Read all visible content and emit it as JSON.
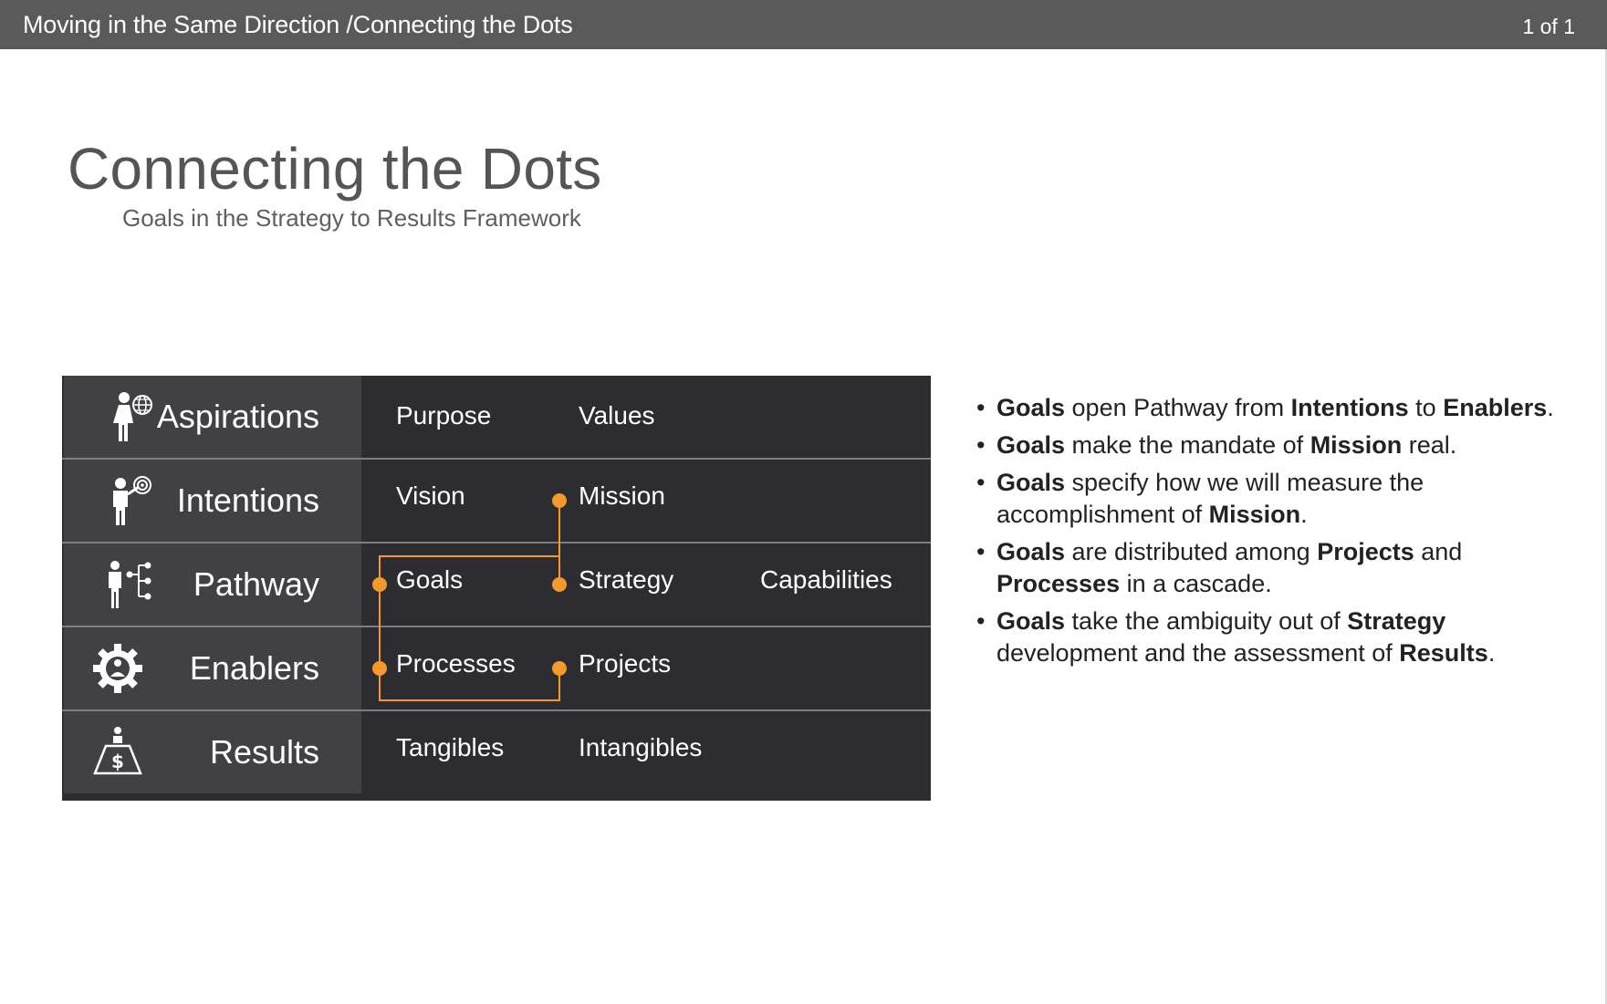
{
  "header": {
    "breadcrumb": "Moving in the Same Direction /Connecting the Dots",
    "page_counter": "1 of 1"
  },
  "slide": {
    "title": "Connecting the Dots",
    "subtitle": "Goals in the Strategy to Results Framework"
  },
  "framework": {
    "rows": [
      {
        "label": "Aspirations",
        "icon": "person-globe-icon",
        "items": [
          "Purpose",
          "Values"
        ]
      },
      {
        "label": "Intentions",
        "icon": "person-target-icon",
        "items": [
          "Vision",
          "Mission"
        ]
      },
      {
        "label": "Pathway",
        "icon": "person-flowchart-icon",
        "items": [
          "Goals",
          "Strategy",
          "Capabilities"
        ]
      },
      {
        "label": "Enablers",
        "icon": "gear-person-icon",
        "items": [
          "Processes",
          "Projects"
        ]
      },
      {
        "label": "Results",
        "icon": "person-dollar-pedestal-icon",
        "items": [
          "Tangibles",
          "Intangibles"
        ]
      }
    ],
    "connector_color": "#f39a2b",
    "panel_color": "#2d2c30",
    "header_color": "#414145"
  },
  "bullets": [
    {
      "parts": [
        {
          "t": "Goals",
          "b": true
        },
        {
          "t": " open Pathway from ",
          "b": false
        },
        {
          "t": "Intentions",
          "b": true
        },
        {
          "t": " to ",
          "b": false
        },
        {
          "t": "Enablers",
          "b": true
        },
        {
          "t": ".",
          "b": false
        }
      ]
    },
    {
      "parts": [
        {
          "t": "Goals",
          "b": true
        },
        {
          "t": " make the mandate of ",
          "b": false
        },
        {
          "t": "Mission",
          "b": true
        },
        {
          "t": " real.",
          "b": false
        }
      ]
    },
    {
      "parts": [
        {
          "t": "Goals",
          "b": true
        },
        {
          "t": " specify how we will measure the accomplishment of ",
          "b": false
        },
        {
          "t": "Mission",
          "b": true
        },
        {
          "t": ".",
          "b": false
        }
      ]
    },
    {
      "parts": [
        {
          "t": "Goals",
          "b": true
        },
        {
          "t": " are distributed among ",
          "b": false
        },
        {
          "t": "Projects",
          "b": true
        },
        {
          "t": " and ",
          "b": false
        },
        {
          "t": "Processes",
          "b": true
        },
        {
          "t": " in a cascade.",
          "b": false
        }
      ]
    },
    {
      "parts": [
        {
          "t": "Goals",
          "b": true
        },
        {
          "t": " take the ambiguity out of ",
          "b": false
        },
        {
          "t": "Strategy",
          "b": true
        },
        {
          "t": " development and the assessment of ",
          "b": false
        },
        {
          "t": "Results",
          "b": true
        },
        {
          "t": ".",
          "b": false
        }
      ]
    }
  ]
}
